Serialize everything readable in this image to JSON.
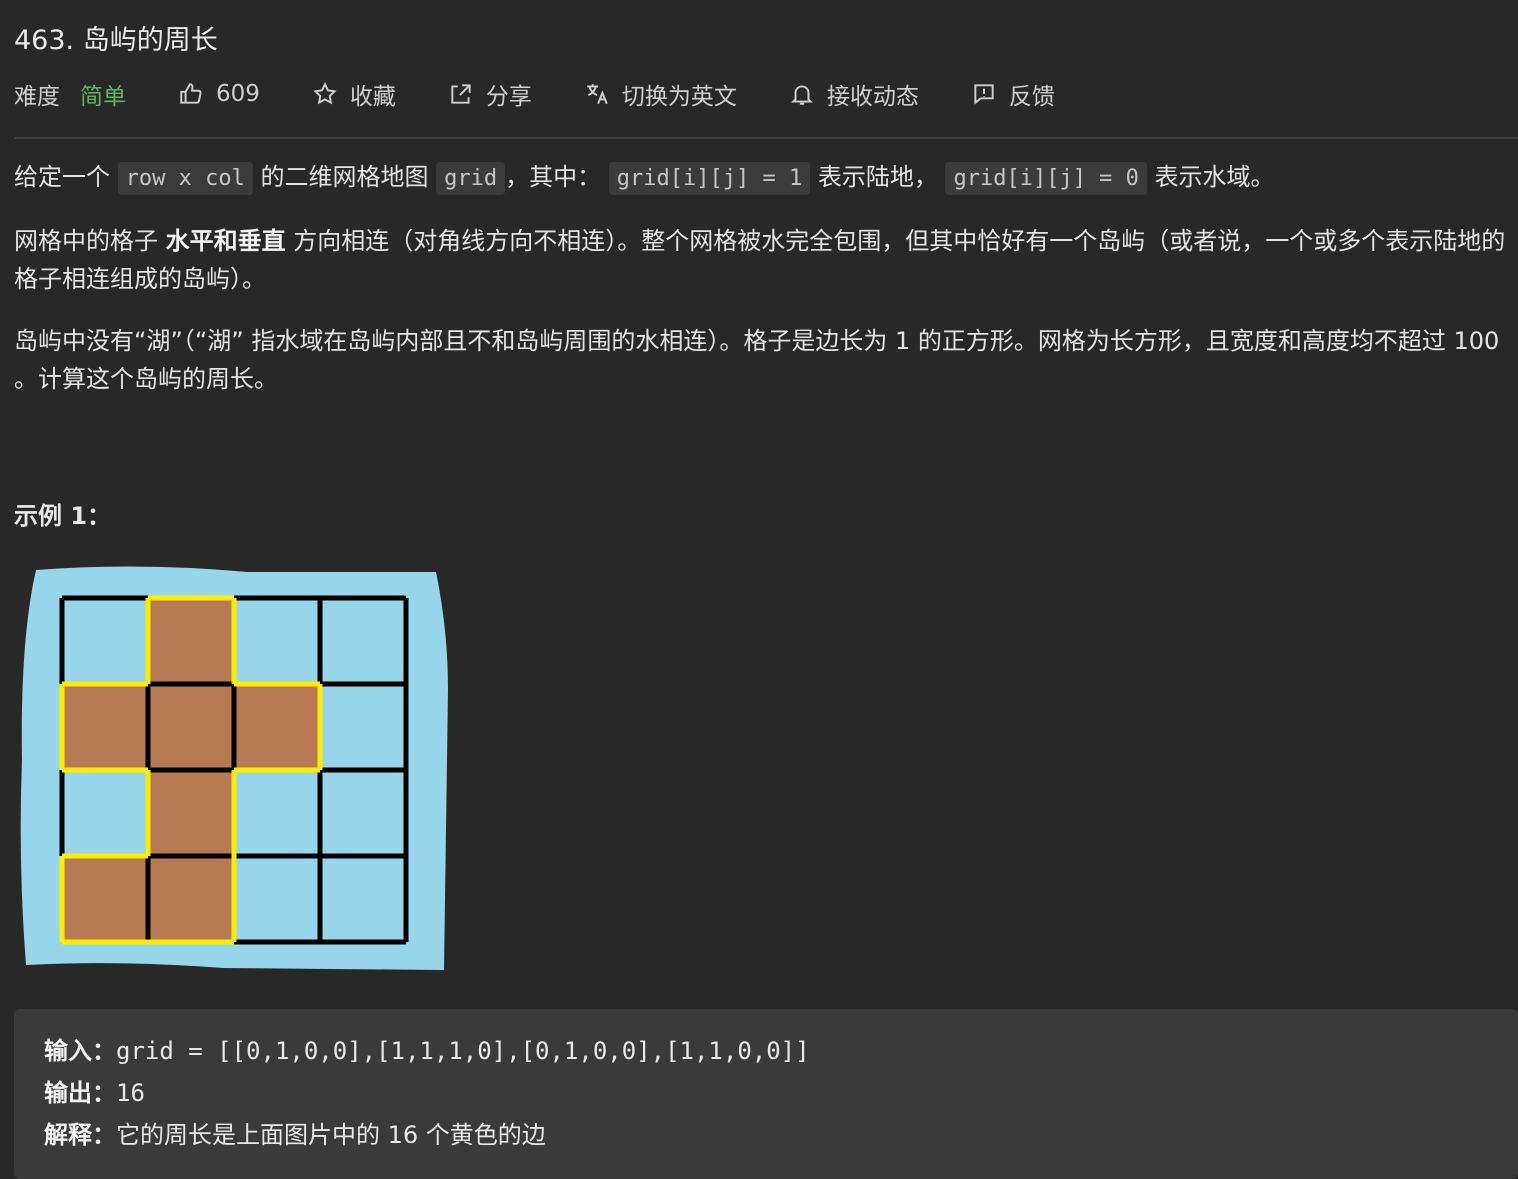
{
  "title": "463. 岛屿的周长",
  "toolbar": {
    "difficulty_label": "难度",
    "difficulty_value": "简单",
    "likes": "609",
    "favorite": "收藏",
    "share": "分享",
    "translate": "切换为英文",
    "subscribe": "接收动态",
    "feedback": "反馈"
  },
  "desc": {
    "p1": {
      "t1": "给定一个",
      "c1": "row x col",
      "t2": "的二维网格地图",
      "c2": "grid",
      "t3": "，其中：",
      "c3": "grid[i][j] = 1",
      "t4": "表示陆地，",
      "c4": "grid[i][j] = 0",
      "t5": "表示水域。"
    },
    "p2": {
      "t1": "网格中的格子 ",
      "b1": "水平和垂直",
      "t2": " 方向相连（对角线方向不相连）。整个网格被水完全包围，但其中恰好有一个岛屿（或者说，一个或多个表示陆地的格子相连组成的岛屿）。"
    },
    "p3": "岛屿中没有“湖”（“湖” 指水域在岛屿内部且不和岛屿周围的水相连）。格子是边长为 1 的正方形。网格为长方形，且宽度和高度均不超过 100 。计算这个岛屿的周长。"
  },
  "example": {
    "title": "示例 1：",
    "grid": [
      [
        0,
        1,
        0,
        0
      ],
      [
        1,
        1,
        1,
        0
      ],
      [
        0,
        1,
        0,
        0
      ],
      [
        1,
        1,
        0,
        0
      ]
    ],
    "colors": {
      "water": "#97d5ea",
      "land": "#b87a55",
      "edge": "#ffec00",
      "line": "#000000"
    },
    "input_label": "输入：",
    "input_value": "grid = [[0,1,0,0],[1,1,1,0],[0,1,0,0],[1,1,0,0]]",
    "output_label": "输出：",
    "output_value": "16",
    "explain_label": "解释：",
    "explain_value": "它的周长是上面图片中的 16 个黄色的边"
  }
}
